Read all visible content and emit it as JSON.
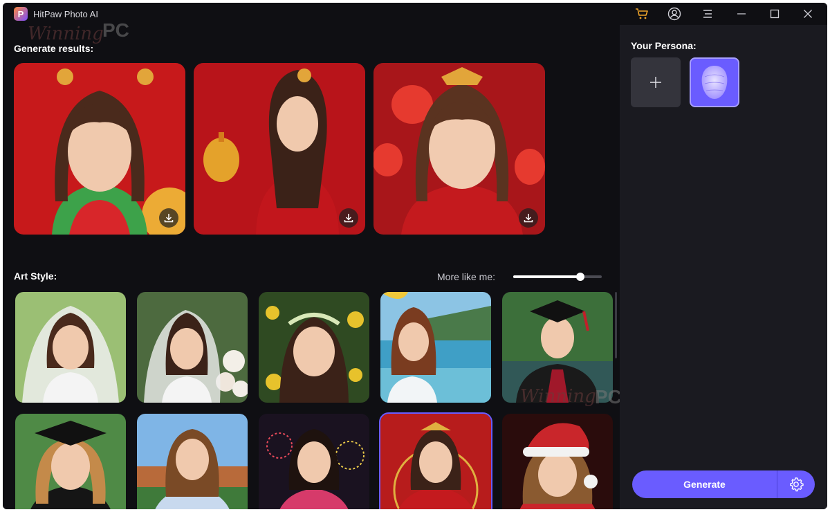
{
  "app": {
    "title": "HitPaw Photo AI",
    "logo_letter": "P"
  },
  "titlebar": {
    "icons": [
      "cart-icon",
      "account-icon",
      "menu-icon",
      "minimize-icon",
      "maximize-icon",
      "close-icon"
    ]
  },
  "watermark": {
    "script": "Winning",
    "pc": "PC"
  },
  "main": {
    "generate_results_label": "Generate results:",
    "results": [
      {
        "name": "generated-result-1",
        "theme": "chinese-new-year",
        "colors": [
          "#c7191b",
          "#3da24a"
        ]
      },
      {
        "name": "generated-result-2",
        "theme": "chinese-new-year-lantern",
        "colors": [
          "#b8141a",
          "#e4a22b"
        ]
      },
      {
        "name": "generated-result-3",
        "theme": "chinese-new-year-lanterns",
        "colors": [
          "#c41a1e",
          "#e63a2f"
        ]
      }
    ],
    "art_style_label": "Art Style:",
    "more_like_me_label": "More like me:",
    "more_like_me_value": 0.76,
    "styles": [
      {
        "name": "style-bridal-veil",
        "colors": [
          "#9bbf74",
          "#efefef"
        ]
      },
      {
        "name": "style-bridal-flowers",
        "colors": [
          "#4d6a3f",
          "#f3efe8"
        ]
      },
      {
        "name": "style-flower-crown",
        "colors": [
          "#2f4a22",
          "#e7c22c"
        ]
      },
      {
        "name": "style-beach",
        "colors": [
          "#3f9fc6",
          "#f2f5f7"
        ]
      },
      {
        "name": "style-graduation-male",
        "colors": [
          "#3c6f3a",
          "#1a1a1a"
        ]
      },
      {
        "name": "style-graduation-female",
        "colors": [
          "#4f8a46",
          "#151515"
        ]
      },
      {
        "name": "style-sports-jersey",
        "colors": [
          "#7fb5e6",
          "#c8d9ee"
        ]
      },
      {
        "name": "style-fireworks",
        "colors": [
          "#1a1220",
          "#d63a6a"
        ]
      },
      {
        "name": "style-chinese-new-year",
        "colors": [
          "#b71c1c",
          "#e0b040"
        ],
        "selected": true
      },
      {
        "name": "style-christmas",
        "colors": [
          "#2a0c0c",
          "#c9262b"
        ]
      }
    ]
  },
  "side": {
    "persona_label": "Your Persona:",
    "add_icon": "plus-icon",
    "avatar_icon": "face-avatar-icon",
    "generate_label": "Generate",
    "settings_icon": "gear-icon"
  },
  "colors": {
    "accent": "#6a5cff",
    "background": "#0f0f13",
    "panel": "#1a1a20",
    "cart": "#f0a52a"
  }
}
